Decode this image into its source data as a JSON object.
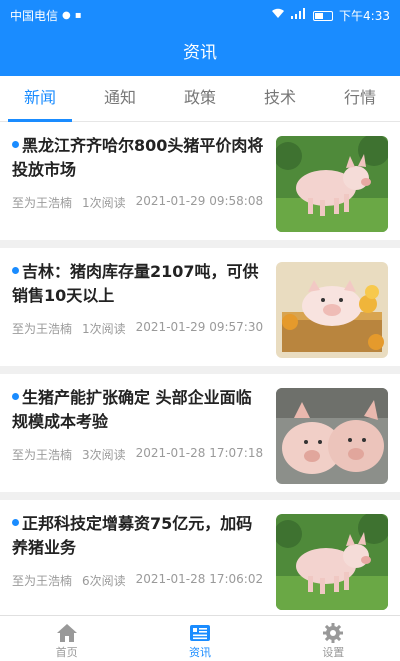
{
  "status_bar": {
    "carrier": "中国电信",
    "time": "下午4:33"
  },
  "app_bar": {
    "title": "资讯"
  },
  "tabs": [
    {
      "label": "新闻",
      "active": true
    },
    {
      "label": "通知",
      "active": false
    },
    {
      "label": "政策",
      "active": false
    },
    {
      "label": "技术",
      "active": false
    },
    {
      "label": "行情",
      "active": false
    }
  ],
  "articles": [
    {
      "title": "黑龙江齐齐哈尔800头猪平价肉将投放市场",
      "author": "至为王浩楠",
      "reads": "1次阅读",
      "date": "2021-01-29 09:58:08",
      "thumb": "pig-on-grass"
    },
    {
      "title": "吉林：猪肉库存量2107吨，可供销售10天以上",
      "author": "至为王浩楠",
      "reads": "1次阅读",
      "date": "2021-01-29 09:57:30",
      "thumb": "piglet-in-basket"
    },
    {
      "title": "生猪产能扩张确定 头部企业面临规模成本考验",
      "author": "至为王浩楠",
      "reads": "3次阅读",
      "date": "2021-01-28 17:07:18",
      "thumb": "two-pigs"
    },
    {
      "title": "正邦科技定增募资75亿元，加码养猪业务",
      "author": "至为王浩楠",
      "reads": "6次阅读",
      "date": "2021-01-28 17:06:02",
      "thumb": "pig-on-grass"
    }
  ],
  "bottom_nav": [
    {
      "label": "首页",
      "icon": "home-icon",
      "active": false
    },
    {
      "label": "资讯",
      "icon": "news-icon",
      "active": true
    },
    {
      "label": "设置",
      "icon": "gear-icon",
      "active": false
    }
  ],
  "colors": {
    "primary": "#1a8cff",
    "meta": "#9a9a9a"
  }
}
